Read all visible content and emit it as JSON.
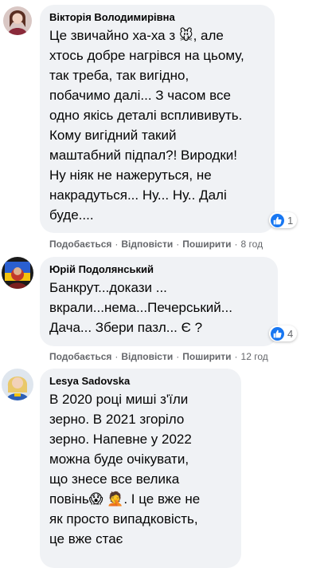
{
  "colors": {
    "bubble": "#f0f2f5",
    "like": "#1877f2",
    "meta": "#65676b"
  },
  "comments": [
    {
      "author": "Вікторія Володимирівна",
      "text": "Це звичайно ха-ха з 🐭, але\nхтось добре нагрівся на цьому,\nтак треба, так вигідно,\nпобачимо далі... З часом все\nодно якісь деталі всплививуть.\nКому вигідний такий\nмаштабний підпал?! Виродки!\nНу ніяк не нажеруться, не\nнакрадуться... Ну... Ну.. Далі\nбуде....",
      "reaction_count": "1",
      "like": "Подобається",
      "reply": "Відповісти",
      "share": "Поширити",
      "time": "8 год"
    },
    {
      "author": "Юрій Подолянський",
      "text": "Банкрут...докази ...\nвкрали...нема...Печерський...\nДача... Збери пазл... Є ?",
      "reaction_count": "4",
      "like": "Подобається",
      "reply": "Відповісти",
      "share": "Поширити",
      "time": "12 год"
    },
    {
      "author": "Lesya Sadovska",
      "text": "В 2020 році миші з'їли\nзерно. В 2021 згоріло\nзерно. Напевне у 2022\nможна буде очікувати,\nщо знесе все велика\nповінь😱 🤦. І це вже не\nяк просто випадковість,\nце вже стає",
      "reaction_count": null
    }
  ],
  "separator": "·",
  "icons": [
    "avatar-woman",
    "avatar-man-flag",
    "avatar-woman-blonde",
    "like-thumb-icon"
  ]
}
